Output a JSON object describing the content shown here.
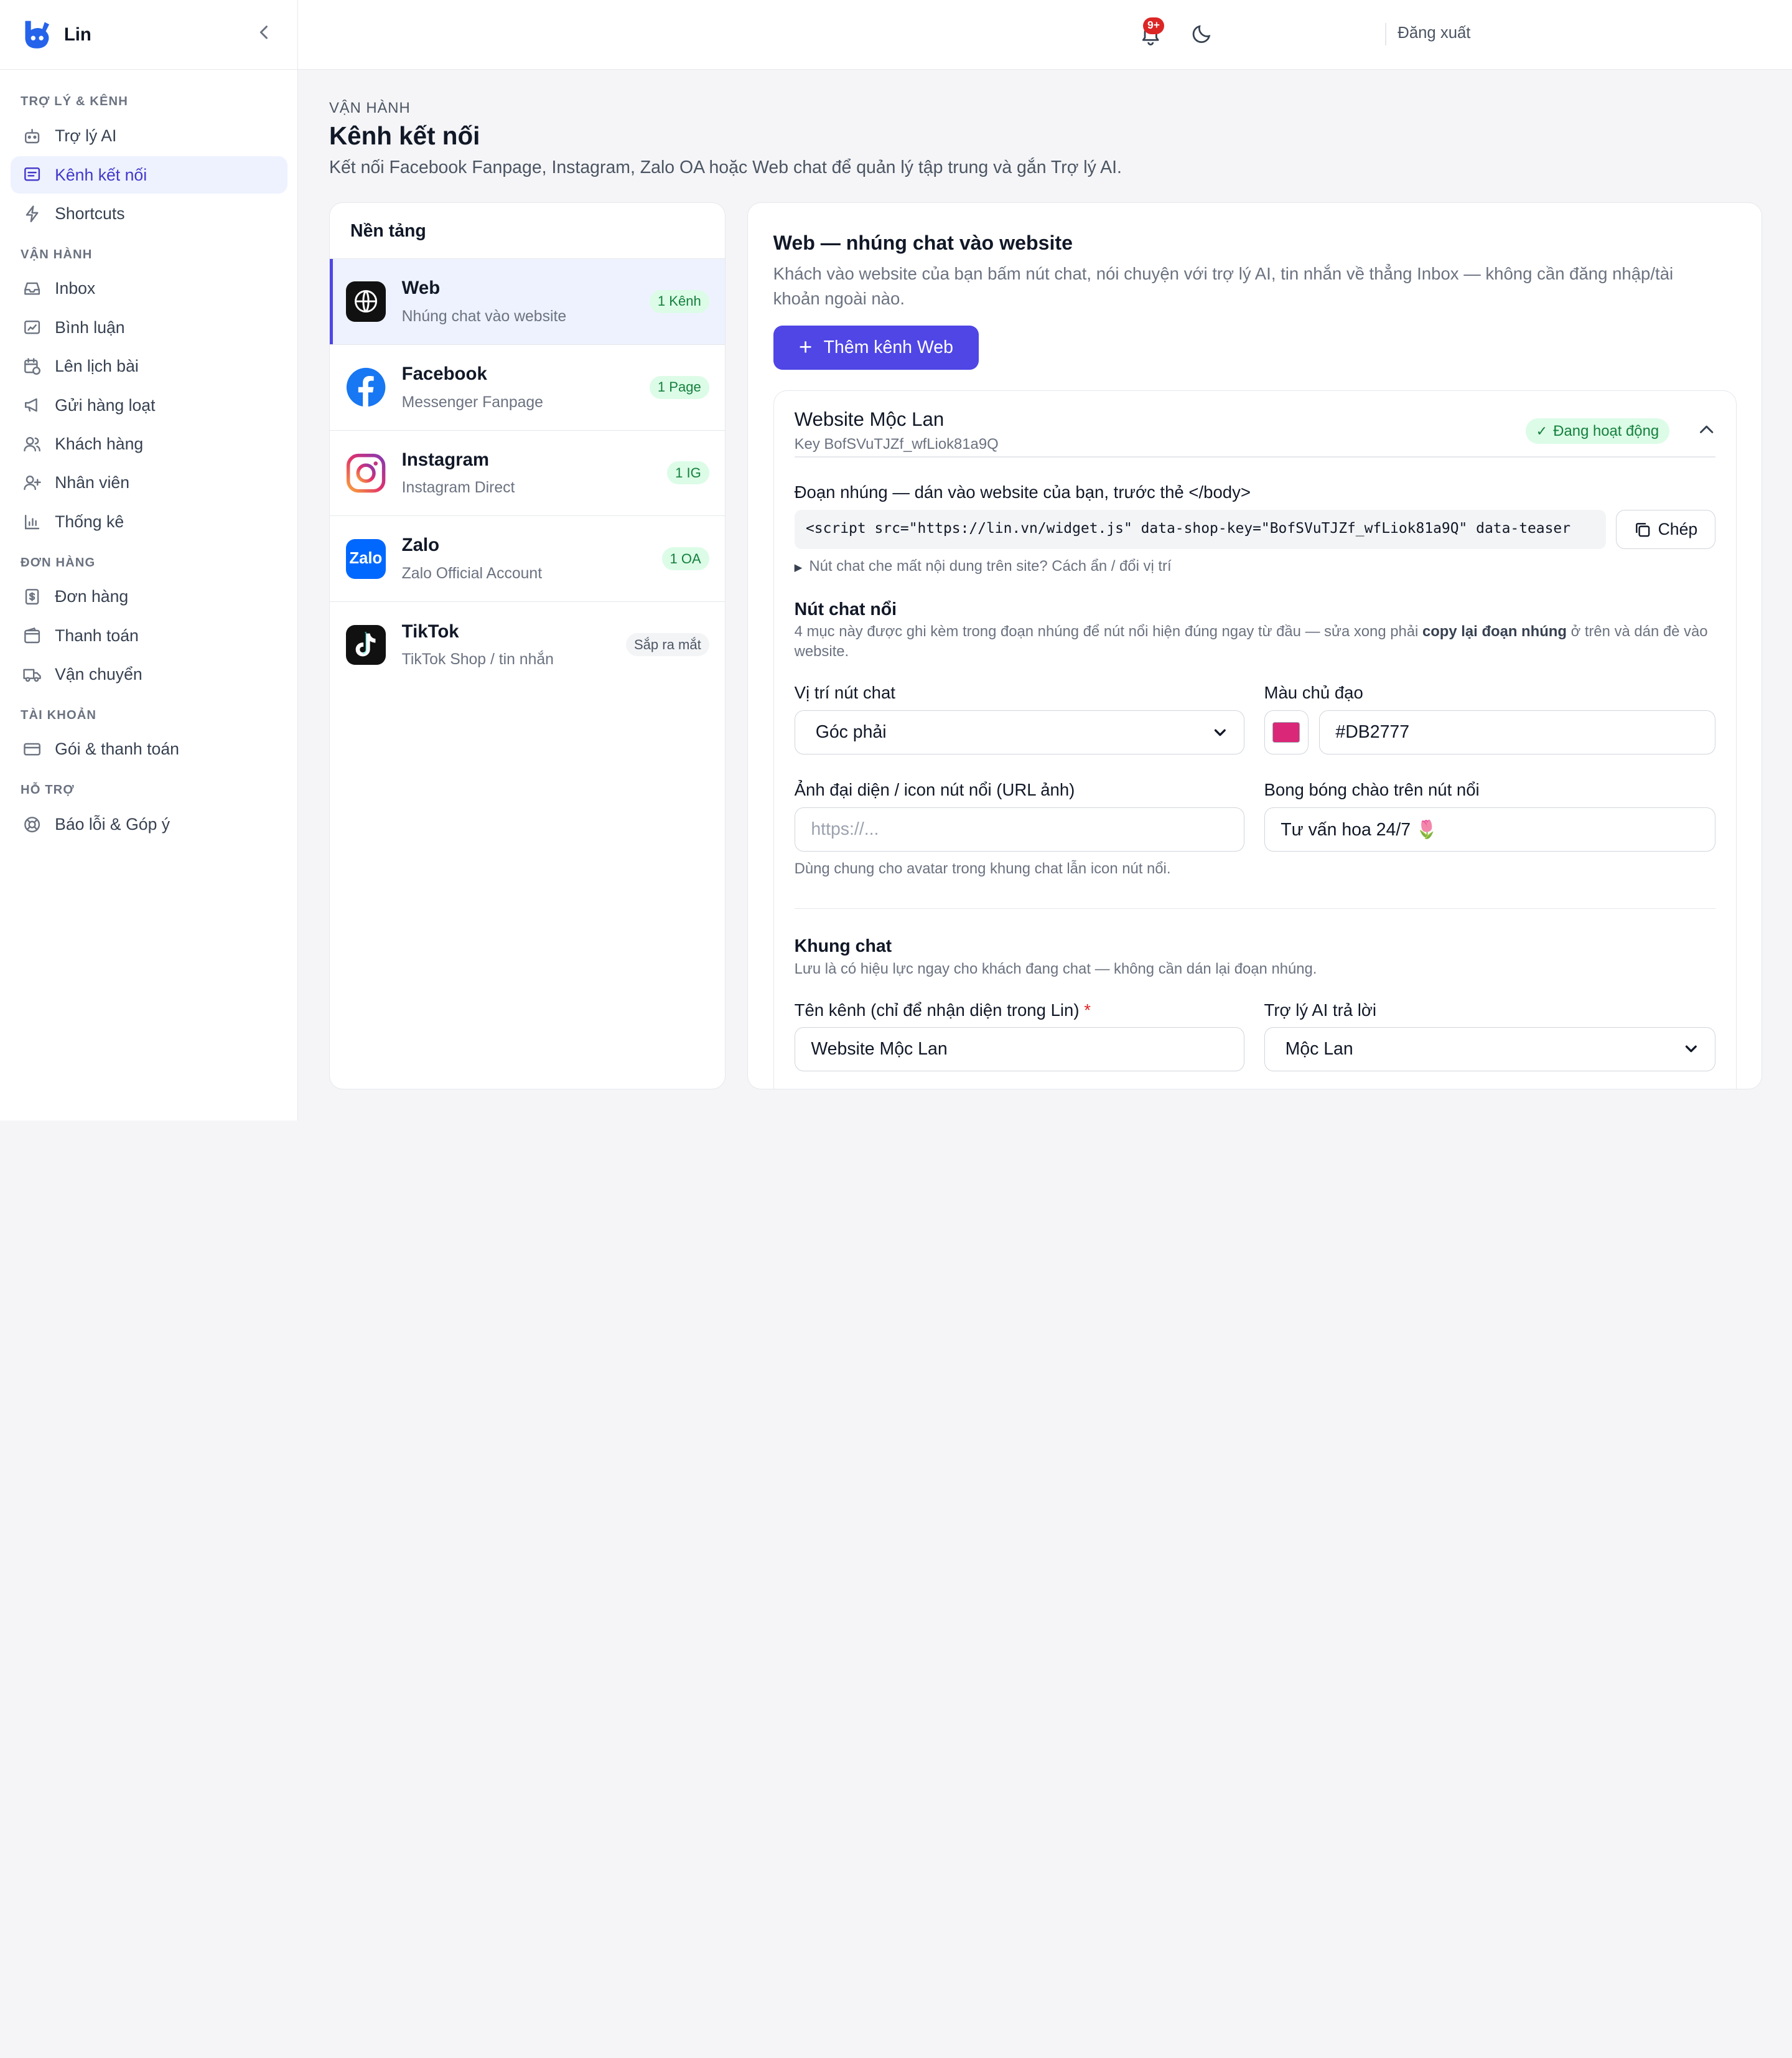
{
  "app": {
    "name": "Lin",
    "logout_label": "Đăng xuất",
    "notif_badge": "9+"
  },
  "sidebar": {
    "sections": [
      {
        "title": "TRỢ LÝ & KÊNH",
        "items": [
          {
            "label": "Trợ lý AI",
            "icon": "bot-icon"
          },
          {
            "label": "Kênh kết nối",
            "icon": "message-square-icon",
            "active": true
          },
          {
            "label": "Shortcuts",
            "icon": "zap-icon"
          }
        ]
      },
      {
        "title": "VẬN HÀNH",
        "items": [
          {
            "label": "Inbox",
            "icon": "inbox-icon"
          },
          {
            "label": "Bình luận",
            "icon": "comment-icon"
          },
          {
            "label": "Lên lịch bài",
            "icon": "calendar-clock-icon"
          },
          {
            "label": "Gửi hàng loạt",
            "icon": "megaphone-icon"
          },
          {
            "label": "Khách hàng",
            "icon": "users-icon"
          },
          {
            "label": "Nhân viên",
            "icon": "user-plus-icon"
          },
          {
            "label": "Thống kê",
            "icon": "bar-chart-icon"
          }
        ]
      },
      {
        "title": "ĐƠN HÀNG",
        "items": [
          {
            "label": "Đơn hàng",
            "icon": "receipt-icon"
          },
          {
            "label": "Thanh toán",
            "icon": "wallet-icon"
          },
          {
            "label": "Vận chuyển",
            "icon": "truck-icon"
          }
        ]
      },
      {
        "title": "TÀI KHOẢN",
        "items": [
          {
            "label": "Gói & thanh toán",
            "icon": "credit-card-icon"
          }
        ]
      },
      {
        "title": "HỖ TRỢ",
        "items": [
          {
            "label": "Báo lỗi & Góp ý",
            "icon": "lifebuoy-icon"
          }
        ]
      }
    ]
  },
  "page": {
    "kicker": "VẬN HÀNH",
    "title": "Kênh kết nối",
    "description": "Kết nối Facebook Fanpage, Instagram, Zalo OA hoặc Web chat để quản lý tập trung và gắn Trợ lý AI."
  },
  "platforms": {
    "heading": "Nền tảng",
    "items": [
      {
        "name": "Web",
        "sub": "Nhúng chat vào website",
        "badge": "1 Kênh",
        "icon": "globe-icon"
      },
      {
        "name": "Facebook",
        "sub": "Messenger Fanpage",
        "badge": "1 Page",
        "icon": "facebook-icon"
      },
      {
        "name": "Instagram",
        "sub": "Instagram Direct",
        "badge": "1 IG",
        "icon": "instagram-icon"
      },
      {
        "name": "Zalo",
        "sub": "Zalo Official Account",
        "badge": "1 OA",
        "icon": "zalo-icon",
        "icon_text": "Zalo"
      },
      {
        "name": "TikTok",
        "sub": "TikTok Shop / tin nhắn",
        "badge": "Sắp ra mắt",
        "icon": "tiktok-icon"
      }
    ]
  },
  "detail": {
    "title": "Web — nhúng chat vào website",
    "description": "Khách vào website của bạn bấm nút chat, nói chuyện với trợ lý AI, tin nhắn về thẳng Inbox — không cần đăng nhập/tài khoản ngoài nào.",
    "add_button": "Thêm kênh Web",
    "channel": {
      "name": "Website Mộc Lan",
      "key": "Key BofSVuTJZf_wfLiok81a9Q",
      "status": "Đang hoạt động",
      "embed_label": "Đoạn nhúng — dán vào website của bạn, trước thẻ </body>",
      "embed_code": "<script src=\"https://lin.vn/widget.js\" data-shop-key=\"BofSVuTJZf_wfLiok81a9Q\" data-teaser",
      "copy_label": "Chép",
      "embed_hint": "Nút chat che mất nội dung trên site? Cách ẩn / đổi vị trí",
      "float_title": "Nút chat nổi",
      "float_desc_1": "4 mục này được ghi kèm trong đoạn nhúng để nút nổi hiện đúng ngay từ đầu — sửa xong phải ",
      "float_desc_bold": "copy lại đoạn nhúng",
      "float_desc_2": " ở trên và dán đè vào website.",
      "position_label": "Vị trí nút chat",
      "position_value": "Góc phải",
      "color_label": "Màu chủ đạo",
      "color_value": "#DB2777",
      "avatar_label": "Ảnh đại diện / icon nút nổi (URL ảnh)",
      "avatar_placeholder": "https://...",
      "bubble_label": "Bong bóng chào trên nút nổi",
      "bubble_value": "Tư vấn hoa 24/7 🌷",
      "avatar_hint": "Dùng chung cho avatar trong khung chat lẫn icon nút nổi.",
      "frame_title": "Khung chat",
      "frame_desc": "Lưu là có hiệu lực ngay cho khách đang chat — không cần dán lại đoạn nhúng.",
      "channel_name_label": "Tên kênh (chỉ để nhận diện trong Lin)",
      "required_mark": "*",
      "channel_name_value": "Website Mộc Lan",
      "assistant_label": "Trợ lý AI trả lời",
      "assistant_value": "Mộc Lan"
    }
  },
  "colors": {
    "accent": "#4f46e5",
    "brand_color": "#DB2777",
    "success": "#15803d",
    "danger": "#dc2626"
  }
}
